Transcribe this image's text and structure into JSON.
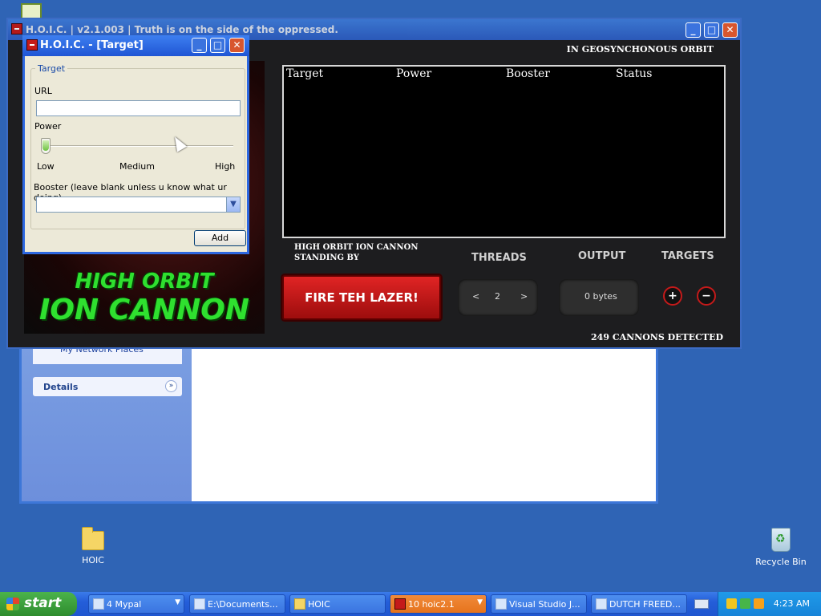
{
  "desktop": {
    "icons": [
      {
        "label": "HOIC",
        "icon": "folder-icon"
      },
      {
        "label": "Recycle Bin",
        "icon": "recycle-bin-icon"
      }
    ]
  },
  "explorer": {
    "link_label": "My Network Places",
    "details_label": "Details"
  },
  "main_window": {
    "title": "H.O.I.C. | v2.1.003 | Truth is on the side of the oppressed.",
    "orbit_status": "IN GEOSYNCHONOUS ORBIT",
    "table_headers": [
      "Target",
      "Power",
      "Booster",
      "Status"
    ],
    "standing_by": "HIGH ORBIT ION CANNON STANDING BY",
    "fire_button": "FIRE TEH LAZER!",
    "threads_label": "THREADS",
    "threads_value": "2",
    "threads_dec": "<",
    "threads_inc": ">",
    "output_label": "OUTPUT",
    "output_value": "0 bytes",
    "targets_label": "TARGETS",
    "add_target": "+",
    "remove_target": "−",
    "cannons_detected": "249 CANNONS DETECTED",
    "banner_line1": "HIGH ORBIT",
    "banner_line2": "ION CANNON"
  },
  "dialog": {
    "title": "H.O.I.C. - [Target]",
    "group_label": "Target",
    "url_label": "URL",
    "url_value": "",
    "power_label": "Power",
    "power_level": 0,
    "power_low": "Low",
    "power_medium": "Medium",
    "power_high": "High",
    "booster_label": "Booster (leave blank unless u know what ur doing)",
    "booster_value": "",
    "add_button": "Add"
  },
  "taskbar": {
    "start_label": "start",
    "tasks": [
      {
        "label": "4 Mypal",
        "active": false
      },
      {
        "label": "E:\\Documents...",
        "active": false
      },
      {
        "label": "HOIC",
        "active": false
      },
      {
        "label": "10 hoic2.1",
        "active": true
      },
      {
        "label": "Visual Studio J...",
        "active": false
      },
      {
        "label": "DUTCH FREED...",
        "active": false
      }
    ],
    "clock": "4:23 AM"
  },
  "colors": {
    "desktop": "#2f64b5",
    "fire_button": "#c41a1a",
    "banner_text": "#2fe02f"
  }
}
